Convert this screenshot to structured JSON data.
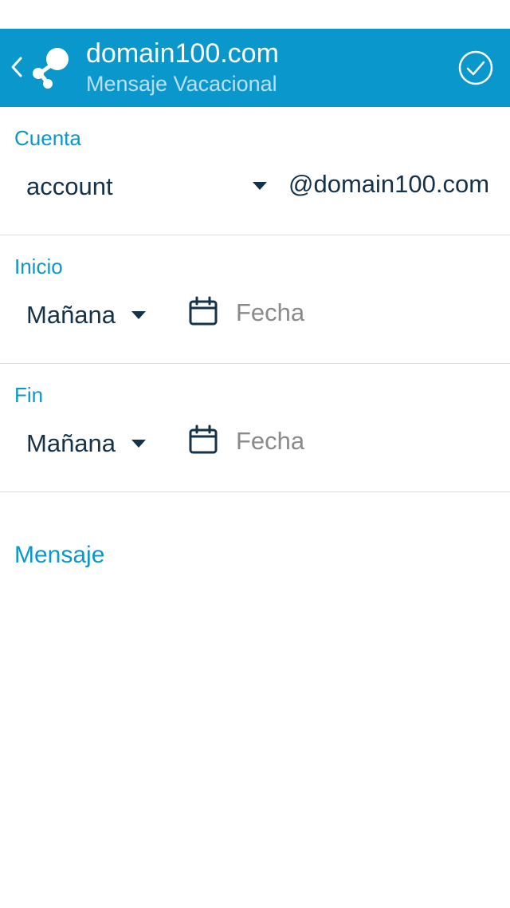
{
  "header": {
    "title": "domain100.com",
    "subtitle": "Mensaje Vacacional",
    "back_icon": "chevron-left-icon",
    "logo_icon": "share-node-icon",
    "confirm_icon": "check-circle-icon"
  },
  "account": {
    "label": "Cuenta",
    "value": "account",
    "domain": "@domain100.com"
  },
  "start": {
    "label": "Inicio",
    "selected": "Mañana",
    "date_placeholder": "Fecha"
  },
  "end": {
    "label": "Fin",
    "selected": "Mañana",
    "date_placeholder": "Fecha"
  },
  "message": {
    "label": "Mensaje"
  },
  "colors": {
    "app_bar": "#0a98cc",
    "accent": "#0a98cc",
    "text": "#14324a",
    "placeholder": "#8a8a8a",
    "divider": "#dcdcdc"
  }
}
